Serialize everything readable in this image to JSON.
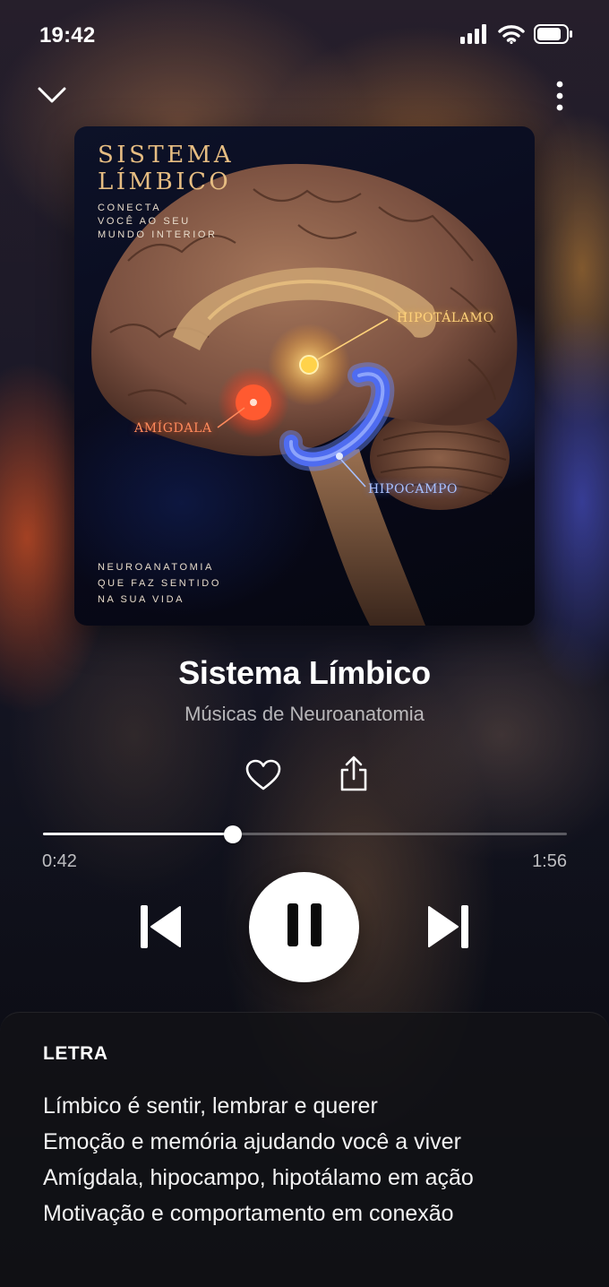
{
  "status_bar": {
    "time": "19:42",
    "icons": [
      "signal-icon",
      "wifi-icon",
      "battery-icon"
    ]
  },
  "header": {
    "collapse_icon": "chevron-down-icon",
    "more_icon": "more-vertical-icon"
  },
  "album_art": {
    "title_line1": "SISTEMA",
    "title_line2": "LÍMBICO",
    "tagline_line1": "CONECTA",
    "tagline_line2": "VOCÊ AO SEU",
    "tagline_line3": "MUNDO INTERIOR",
    "labels": {
      "hipotalamo": "HIPOTÁLAMO",
      "amigdala": "AMÍGDALA",
      "hipocampo": "HIPOCAMPO"
    },
    "footer_line1": "NEUROANATOMIA",
    "footer_line2": "QUE FAZ SENTIDO",
    "footer_line3": "NA SUA VIDA"
  },
  "track": {
    "title": "Sistema Límbico",
    "artist": "Músicas de Neuroanatomia"
  },
  "actions": {
    "like_icon": "heart-icon",
    "share_icon": "share-icon"
  },
  "playback": {
    "elapsed": "0:42",
    "total": "1:56",
    "progress_fraction": 0.362,
    "state": "playing",
    "prev_icon": "skip-previous-icon",
    "pause_icon": "pause-icon",
    "next_icon": "skip-next-icon"
  },
  "lyrics": {
    "heading": "LETRA",
    "lines": [
      "Límbico é sentir, lembrar e querer",
      "Emoção e memória ajudando você a viver",
      "Amígdala, hipocampo, hipotálamo em ação",
      "Motivação e comportamento em conexão"
    ]
  }
}
